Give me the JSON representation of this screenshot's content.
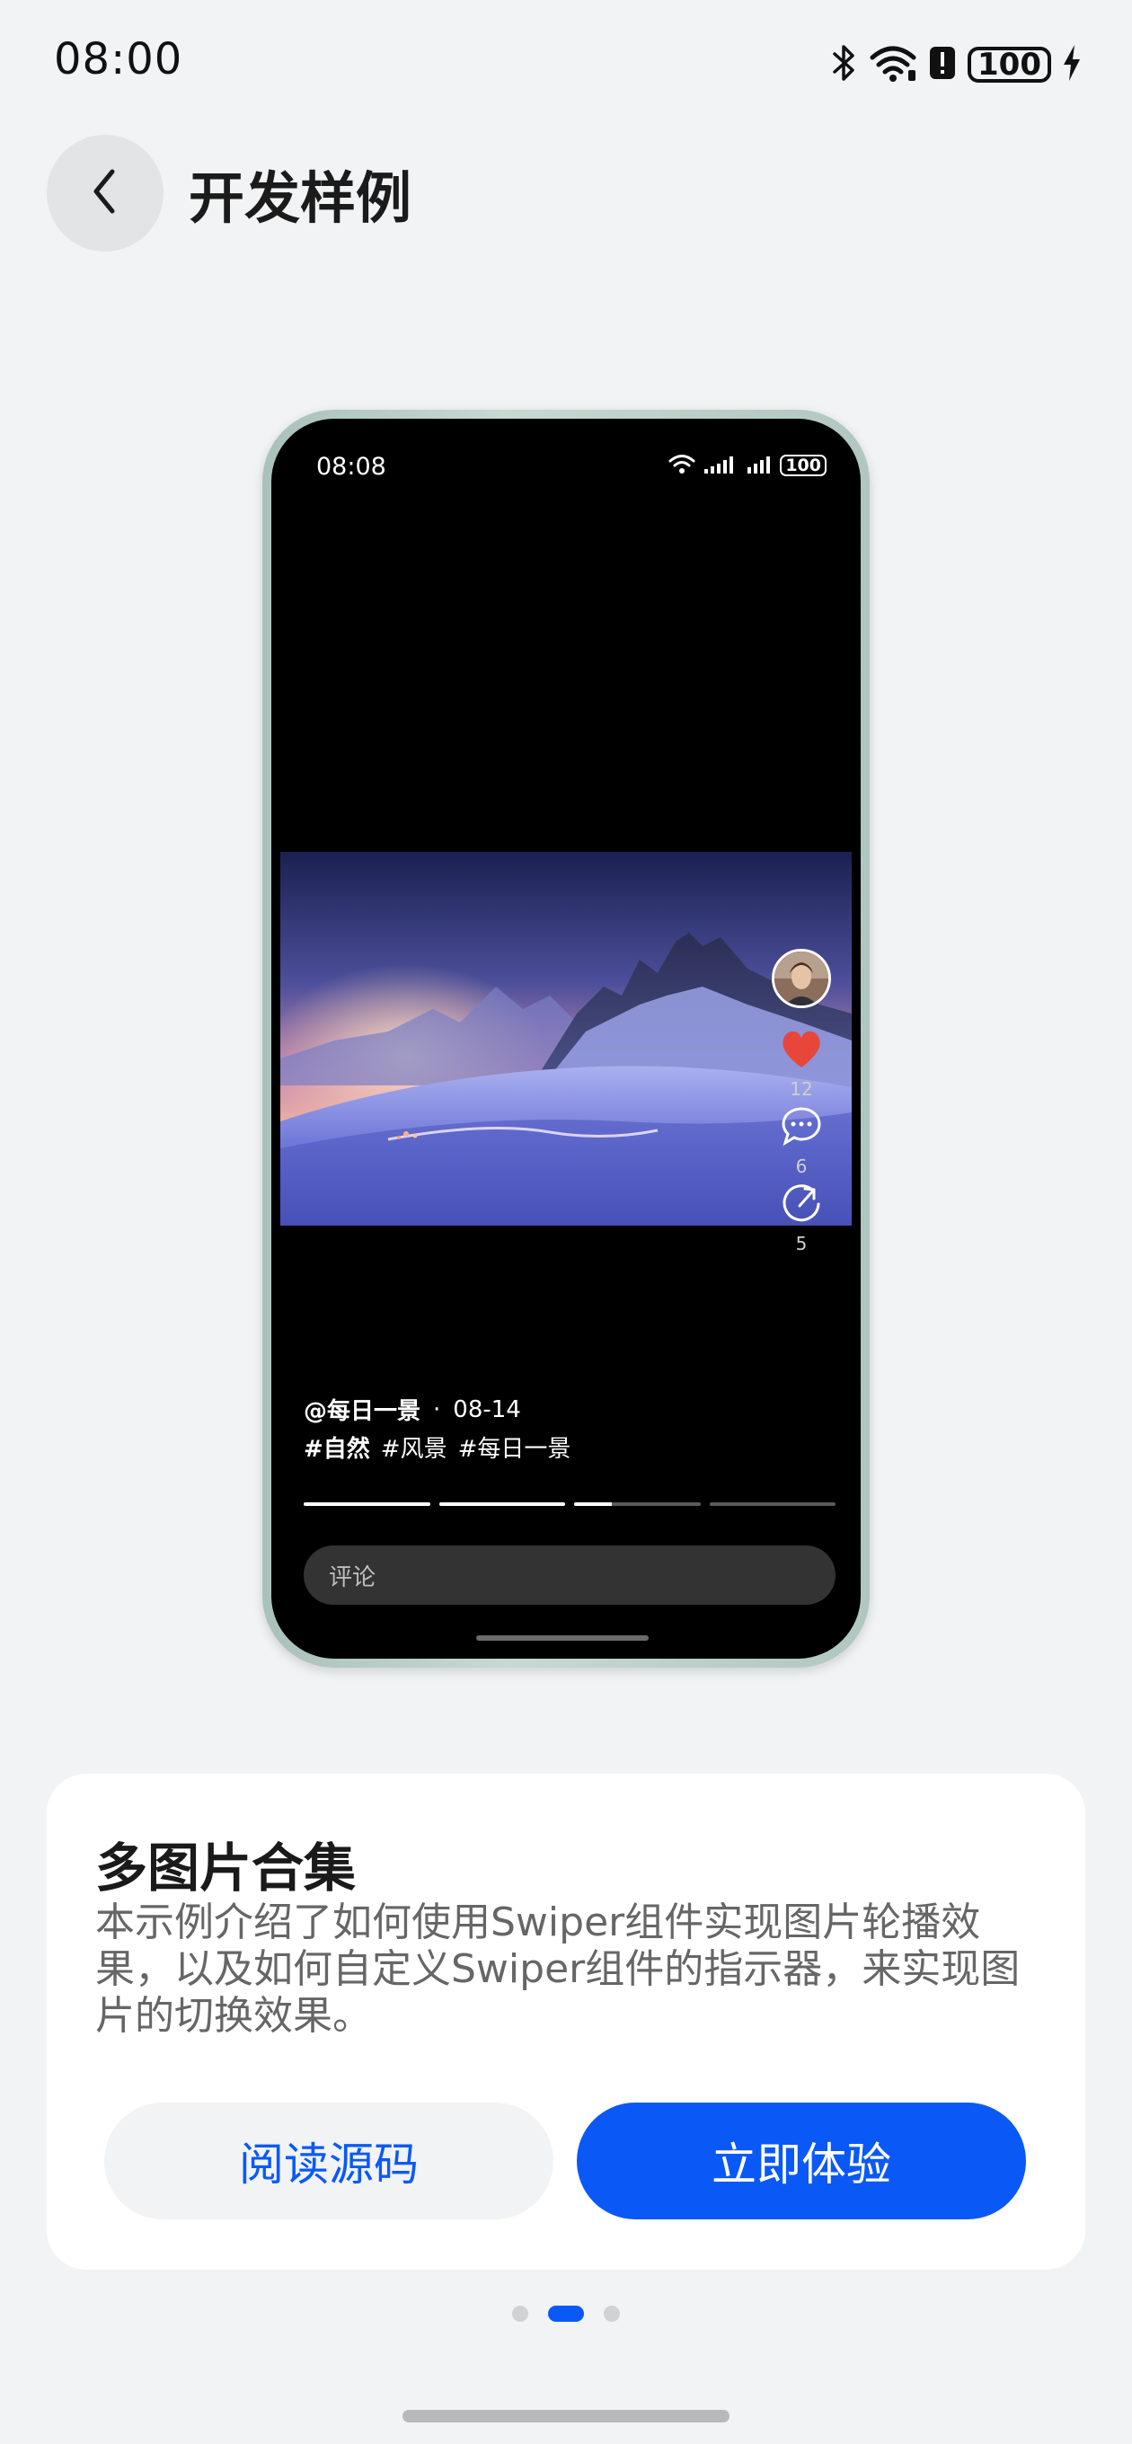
{
  "status_bar": {
    "time": "08:00",
    "battery": "100"
  },
  "header": {
    "title": "开发样例"
  },
  "preview": {
    "time": "08:08",
    "battery": "100",
    "likes": "12",
    "comments": "6",
    "shares": "5",
    "author": "@每日一景",
    "date": "08-14",
    "tags": [
      "#自然",
      "#风景",
      "#每日一景"
    ],
    "comment_placeholder": "评论",
    "progress": [
      1,
      1,
      0.3,
      0
    ],
    "colors": {
      "like": "#e8463a"
    }
  },
  "card": {
    "title": "多图片合集",
    "description": "本示例介绍了如何使用Swiper组件实现图片轮播效果，以及如何自定义Swiper组件的指示器，来实现图片的切换效果。",
    "read_source_label": "阅读源码",
    "try_now_label": "立即体验"
  },
  "page_indicator": {
    "count": 3,
    "active": 1
  },
  "colors": {
    "accent": "#0a59f7",
    "background": "#f1f3f5"
  }
}
